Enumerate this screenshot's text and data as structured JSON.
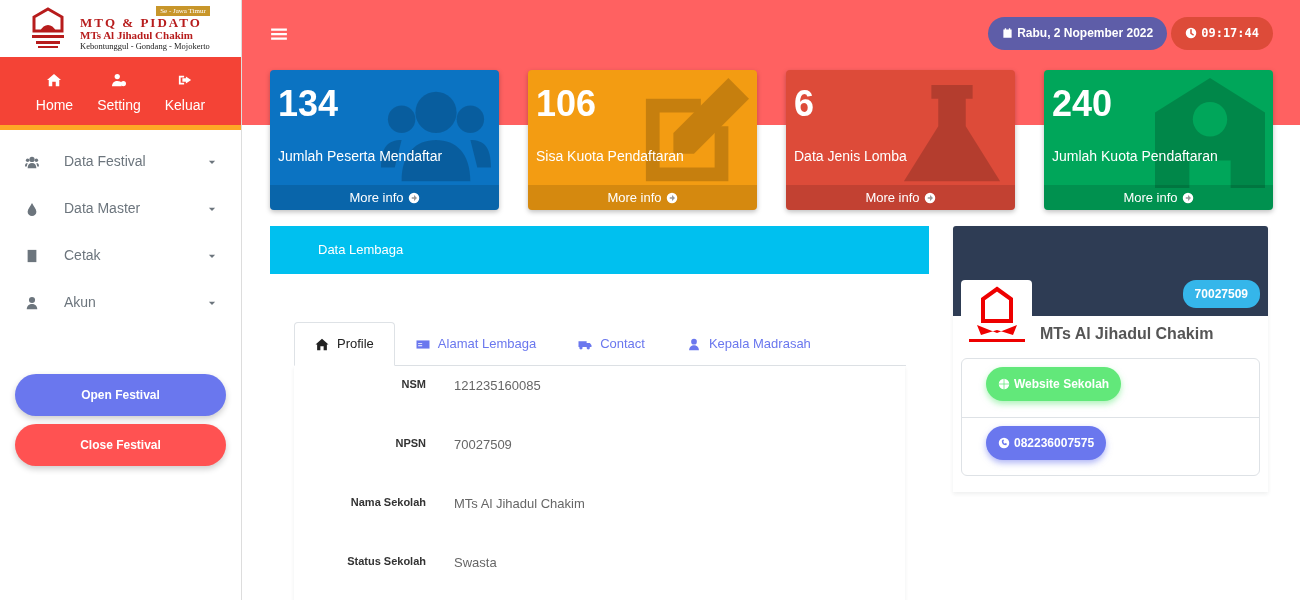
{
  "brand": {
    "region_tag": "Se - Jawa Timur",
    "title": "MTQ & PIDATO",
    "school": "MTs Al Jihadul Chakim",
    "address": "Kebontunggul - Gondang - Mojokerto"
  },
  "top_menu": [
    {
      "label": "Home"
    },
    {
      "label": "Setting"
    },
    {
      "label": "Keluar"
    }
  ],
  "sidebar": {
    "items": [
      {
        "label": "Data Festival"
      },
      {
        "label": "Data Master"
      },
      {
        "label": "Cetak"
      },
      {
        "label": "Akun"
      }
    ]
  },
  "festival_buttons": [
    {
      "label": "Open Festival",
      "color": "#6a77ee"
    },
    {
      "label": "Close Festival",
      "color": "#ff5252"
    }
  ],
  "header": {
    "date": "Rabu, 2 Nopember 2022",
    "time": "09:17:44"
  },
  "stats": [
    {
      "value": "134",
      "label": "Jumlah Peserta Mendaftar",
      "link": "More info",
      "color": "#0b73c2"
    },
    {
      "value": "106",
      "label": "Sisa Kuota Pendaftaran",
      "link": "More info",
      "color": "#f39c12"
    },
    {
      "value": "6",
      "label": "Data Jenis Lomba",
      "link": "More info",
      "color": "#dd4b39"
    },
    {
      "value": "240",
      "label": "Jumlah Kuota Pendaftaran",
      "link": "More info",
      "color": "#00a65a"
    }
  ],
  "panel": {
    "title": "Data Lembaga",
    "tabs": [
      {
        "label": "Profile",
        "selected": true
      },
      {
        "label": "Alamat Lembaga",
        "selected": false
      },
      {
        "label": "Contact",
        "selected": false
      },
      {
        "label": "Kepala Madrasah",
        "selected": false
      }
    ],
    "fields": [
      {
        "label": "NSM",
        "value": "121235160085"
      },
      {
        "label": "NPSN",
        "value": "70027509"
      },
      {
        "label": "Nama Sekolah",
        "value": "MTs Al Jihadul Chakim"
      },
      {
        "label": "Status Sekolah",
        "value": "Swasta"
      }
    ]
  },
  "profile": {
    "badge": "70027509",
    "name": "MTs Al Jihadul Chakim",
    "links": [
      {
        "kind": "website",
        "label": "Website Sekolah"
      },
      {
        "kind": "whatsapp",
        "label": "082236007575"
      }
    ]
  }
}
